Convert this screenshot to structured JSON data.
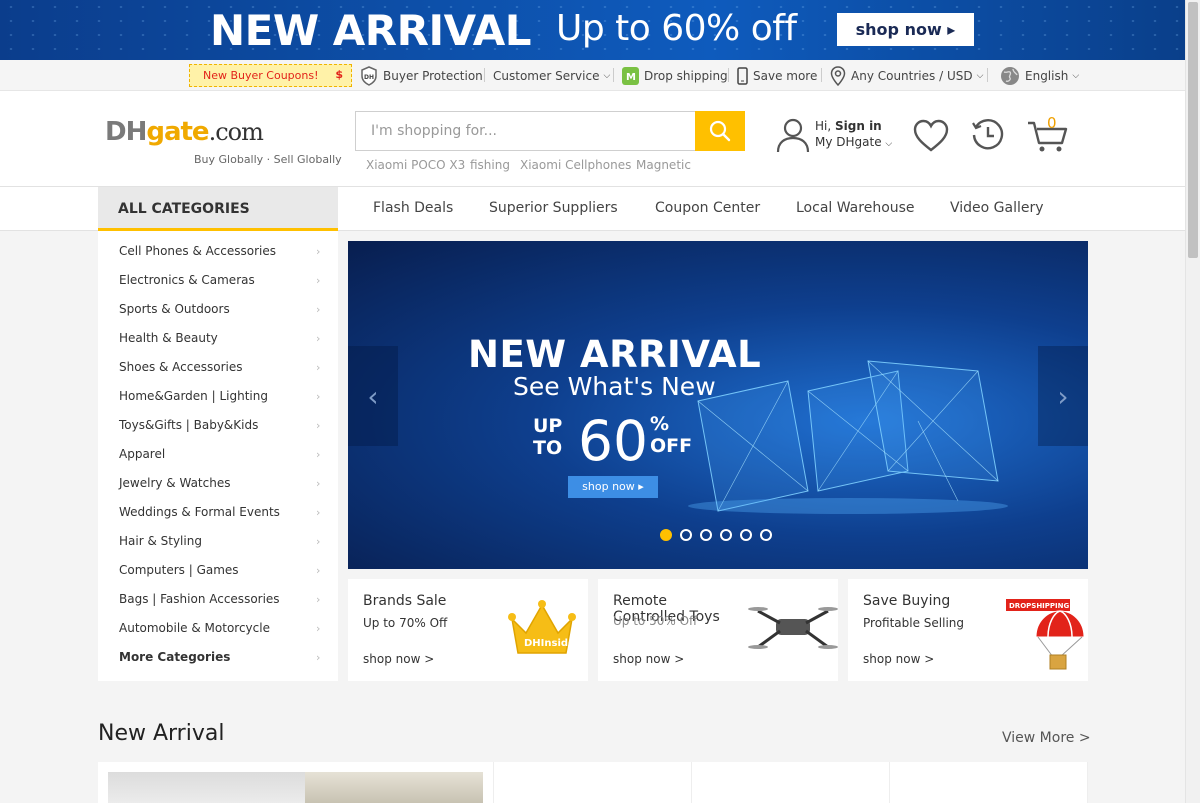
{
  "top_banner": {
    "headline": "NEW ARRIVAL",
    "offer": "Up to 60% off",
    "cta": "shop now"
  },
  "utility_bar": {
    "coupon": "New Buyer Coupons!",
    "coupon_symbol": "$",
    "buyer_protection": "Buyer Protection",
    "customer_service": "Customer Service",
    "drop_shipping": "Drop shipping",
    "save_more": "Save more",
    "region": "Any Countries / USD",
    "language": "English"
  },
  "header": {
    "logo_dh": "DH",
    "logo_gate": "gate",
    "logo_com": ".com",
    "tagline": "Buy Globally · Sell Globally",
    "search_placeholder": "I'm shopping for...",
    "hot_words": [
      "Xiaomi POCO X3",
      "fishing",
      "Xiaomi Cellphones",
      "Magnetic"
    ],
    "account_hi": "Hi,",
    "account_signin": "Sign in",
    "account_my": "My DHgate",
    "cart_count": "0"
  },
  "nav": {
    "all_categories": "ALL CATEGORIES",
    "links": [
      "Flash Deals",
      "Superior Suppliers",
      "Coupon Center",
      "Local Warehouse",
      "Video Gallery"
    ]
  },
  "categories": [
    "Cell Phones & Accessories",
    "Electronics & Cameras",
    "Sports & Outdoors",
    "Health & Beauty",
    "Shoes & Accessories",
    "Home&Garden  | Lighting",
    "Toys&Gifts  | Baby&Kids",
    "Apparel",
    "Jewelry & Watches",
    "Weddings & Formal Events",
    "Hair & Styling",
    "Computers  | Games",
    "Bags  | Fashion Accessories",
    "Automobile & Motorcycle",
    "More Categories"
  ],
  "hero": {
    "headline": "NEW ARRIVAL",
    "subheadline": "See What's New",
    "up_line1": "UP",
    "up_line2": "TO",
    "number": "60",
    "pct_line1": "%",
    "pct_line2": "OFF",
    "cta": "shop now",
    "slide_count": 6,
    "active_slide": 1
  },
  "promo_cards": [
    {
      "title": "Brands Sale",
      "subtitle": "Up to 70% Off",
      "link": "shop now >",
      "badge": "DHInsiders"
    },
    {
      "title": "Remote Controlled Toys",
      "subtitle": "Up to 50% Off",
      "link": "shop now >"
    },
    {
      "title": "Save Buying",
      "subtitle": "Profitable Selling",
      "link": "shop now >",
      "badge": "DROPSHIPPING"
    }
  ],
  "new_arrival": {
    "title": "New Arrival",
    "view_more": "View More  >"
  },
  "colors": {
    "accent": "#ffc000",
    "banner_blue": "#0d4fa8",
    "cart_count": "#f0a000",
    "coupon_red": "#e2231a"
  }
}
